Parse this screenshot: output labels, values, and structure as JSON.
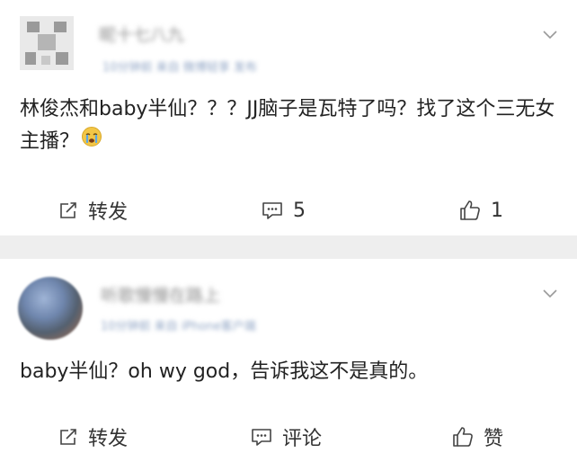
{
  "posts": [
    {
      "author_name": "昵十七八九",
      "meta": "10分钟前 来自 微博轻享 发布",
      "content_text": "林俊杰和baby半仙？？？JJ脑子是瓦特了吗？找了这个三无女主播？",
      "emoji_icon": "crying-face-icon",
      "repost_label": "转发",
      "comment_label": "5",
      "like_label": "1"
    },
    {
      "author_name": "听歌慢慢在路上",
      "meta": "10分钟前 来自 iPhone客户端",
      "content_text": "baby半仙？oh wy god，告诉我这不是真的。",
      "repost_label": "转发",
      "comment_label": "评论",
      "like_label": "赞"
    }
  ],
  "colors": {
    "separator": "#eeeeee",
    "icon": "#444444"
  }
}
